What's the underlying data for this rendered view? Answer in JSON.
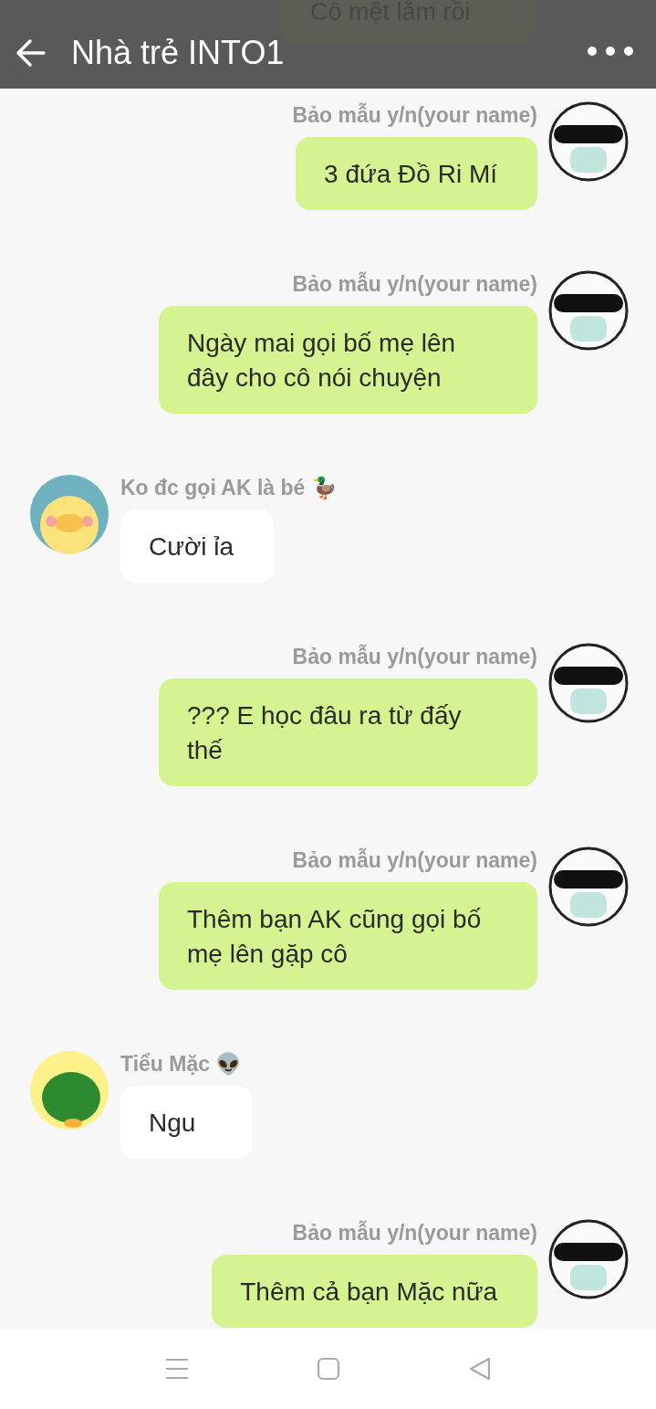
{
  "header": {
    "title": "Nhà trẻ INTO1",
    "hidden_message": "Cô mệt lắm rồi"
  },
  "messages": [
    {
      "kind": "sent",
      "sender": "Bảo mẫu y/n(your name)",
      "text": "3 đứa Đồ Ri Mí",
      "avatar": {
        "kind": "masked"
      }
    },
    {
      "kind": "sent",
      "sender": "Bảo mẫu y/n(your name)",
      "text": "Ngày mai gọi bố mẹ lên đây cho cô nói chuyện",
      "avatar": {
        "kind": "masked"
      }
    },
    {
      "kind": "received",
      "sender": "Ko đc gọi AK là bé 🦆",
      "text": "Cười ỉa",
      "avatar": {
        "kind": "duck"
      }
    },
    {
      "kind": "sent",
      "sender": "Bảo mẫu y/n(your name)",
      "text": "??? E học đâu ra từ đấy thế",
      "avatar": {
        "kind": "masked"
      }
    },
    {
      "kind": "sent",
      "sender": "Bảo mẫu y/n(your name)",
      "text": "Thêm bạn AK cũng gọi bố mẹ lên gặp cô",
      "avatar": {
        "kind": "masked"
      }
    },
    {
      "kind": "received",
      "sender": "Tiểu Mặc 👽",
      "text": "Ngu",
      "avatar": {
        "kind": "croc"
      }
    },
    {
      "kind": "sent",
      "sender": "Bảo mẫu y/n(your name)",
      "text": "Thêm cả bạn Mặc nữa",
      "avatar": {
        "kind": "masked"
      }
    }
  ]
}
